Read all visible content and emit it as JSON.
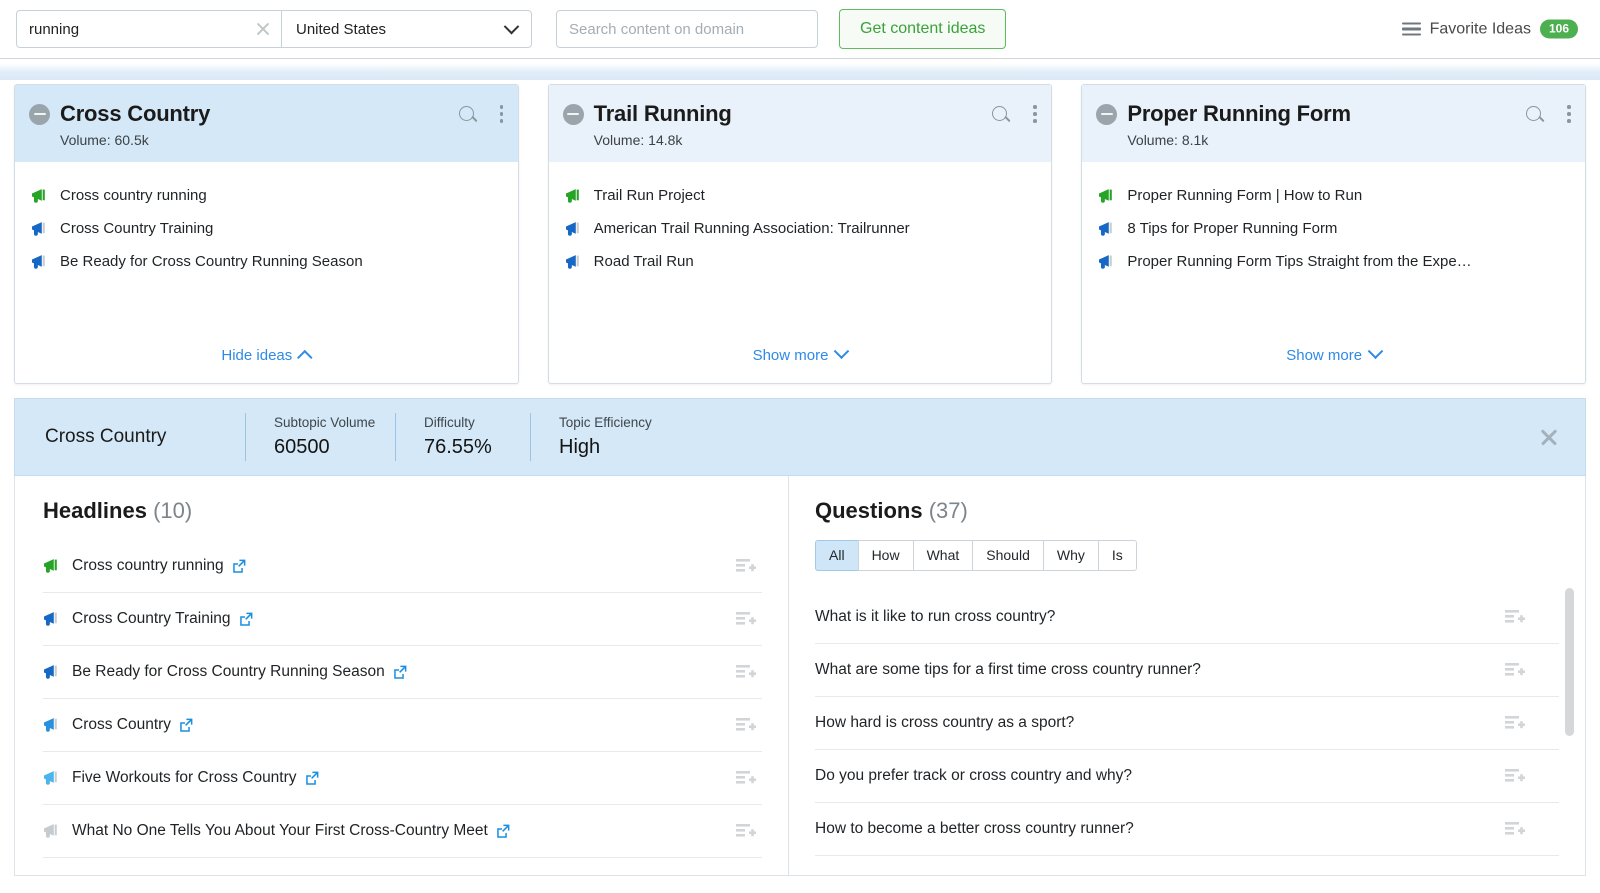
{
  "topbar": {
    "keyword_value": "running",
    "keyword_placeholder": "Enter keyword",
    "country": "United States",
    "domain_placeholder": "Search content on domain",
    "domain_value": "",
    "cta_label": "Get content ideas",
    "favorite_label": "Favorite Ideas",
    "favorite_count": "106"
  },
  "cards": [
    {
      "title": "Cross Country",
      "volume_label": "Volume:",
      "volume_value": "60.5k",
      "selected": true,
      "toggle_label": "Hide ideas",
      "toggle_dir": "up",
      "ideas": [
        {
          "text": "Cross country running",
          "tone": "green"
        },
        {
          "text": "Cross Country Training",
          "tone": "blue-dark"
        },
        {
          "text": "Be Ready for Cross Country Running Season",
          "tone": "blue-dark"
        }
      ]
    },
    {
      "title": "Trail Running",
      "volume_label": "Volume:",
      "volume_value": "14.8k",
      "selected": false,
      "toggle_label": "Show more",
      "toggle_dir": "down",
      "ideas": [
        {
          "text": "Trail Run Project",
          "tone": "green"
        },
        {
          "text": "American Trail Running Association: Trailrunner",
          "tone": "blue-dark"
        },
        {
          "text": "Road Trail Run",
          "tone": "blue-dark"
        }
      ]
    },
    {
      "title": "Proper Running Form",
      "volume_label": "Volume:",
      "volume_value": "8.1k",
      "selected": false,
      "toggle_label": "Show more",
      "toggle_dir": "down",
      "ideas": [
        {
          "text": "Proper Running Form | How to Run",
          "tone": "green"
        },
        {
          "text": "8 Tips for Proper Running Form",
          "tone": "blue-dark"
        },
        {
          "text": "Proper Running Form Tips Straight from the Expe…",
          "tone": "blue-dark"
        }
      ]
    }
  ],
  "detail_bar": {
    "subtopic": "Cross Country",
    "metrics": [
      {
        "label": "Subtopic Volume",
        "value": "60500"
      },
      {
        "label": "Difficulty",
        "value": "76.55%"
      },
      {
        "label": "Topic Efficiency",
        "value": "High"
      }
    ]
  },
  "headlines": {
    "title": "Headlines",
    "count": "(10)",
    "items": [
      {
        "text": "Cross country running",
        "tone": "green"
      },
      {
        "text": "Cross Country Training",
        "tone": "blue-dark"
      },
      {
        "text": "Be Ready for Cross Country Running Season",
        "tone": "blue-dark"
      },
      {
        "text": "Cross Country",
        "tone": "blue-mid"
      },
      {
        "text": "Five Workouts for Cross Country",
        "tone": "blue-light"
      },
      {
        "text": "What No One Tells You About Your First Cross-Country Meet",
        "tone": "gray"
      }
    ]
  },
  "questions": {
    "title": "Questions",
    "count": "(37)",
    "tabs": [
      {
        "label": "All",
        "active": true
      },
      {
        "label": "How",
        "active": false
      },
      {
        "label": "What",
        "active": false
      },
      {
        "label": "Should",
        "active": false
      },
      {
        "label": "Why",
        "active": false
      },
      {
        "label": "Is",
        "active": false
      }
    ],
    "items": [
      {
        "text": "What is it like to run cross country?"
      },
      {
        "text": "What are some tips for a first time cross country runner?"
      },
      {
        "text": "How hard is cross country as a sport?"
      },
      {
        "text": "Do you prefer track or cross country and why?"
      },
      {
        "text": "How to become a better cross country runner?"
      }
    ]
  },
  "colors": {
    "accent_green": "#4caf50",
    "link_blue": "#2e8ae6",
    "selected_header": "#d4e8f7",
    "normal_header": "#e9f1fa",
    "megaphone_green": "#27a327",
    "megaphone_blue_dark": "#1668c4",
    "megaphone_blue_mid": "#2a8fdd",
    "megaphone_blue_light": "#4bb4ef",
    "megaphone_gray": "#c6cbcf"
  }
}
